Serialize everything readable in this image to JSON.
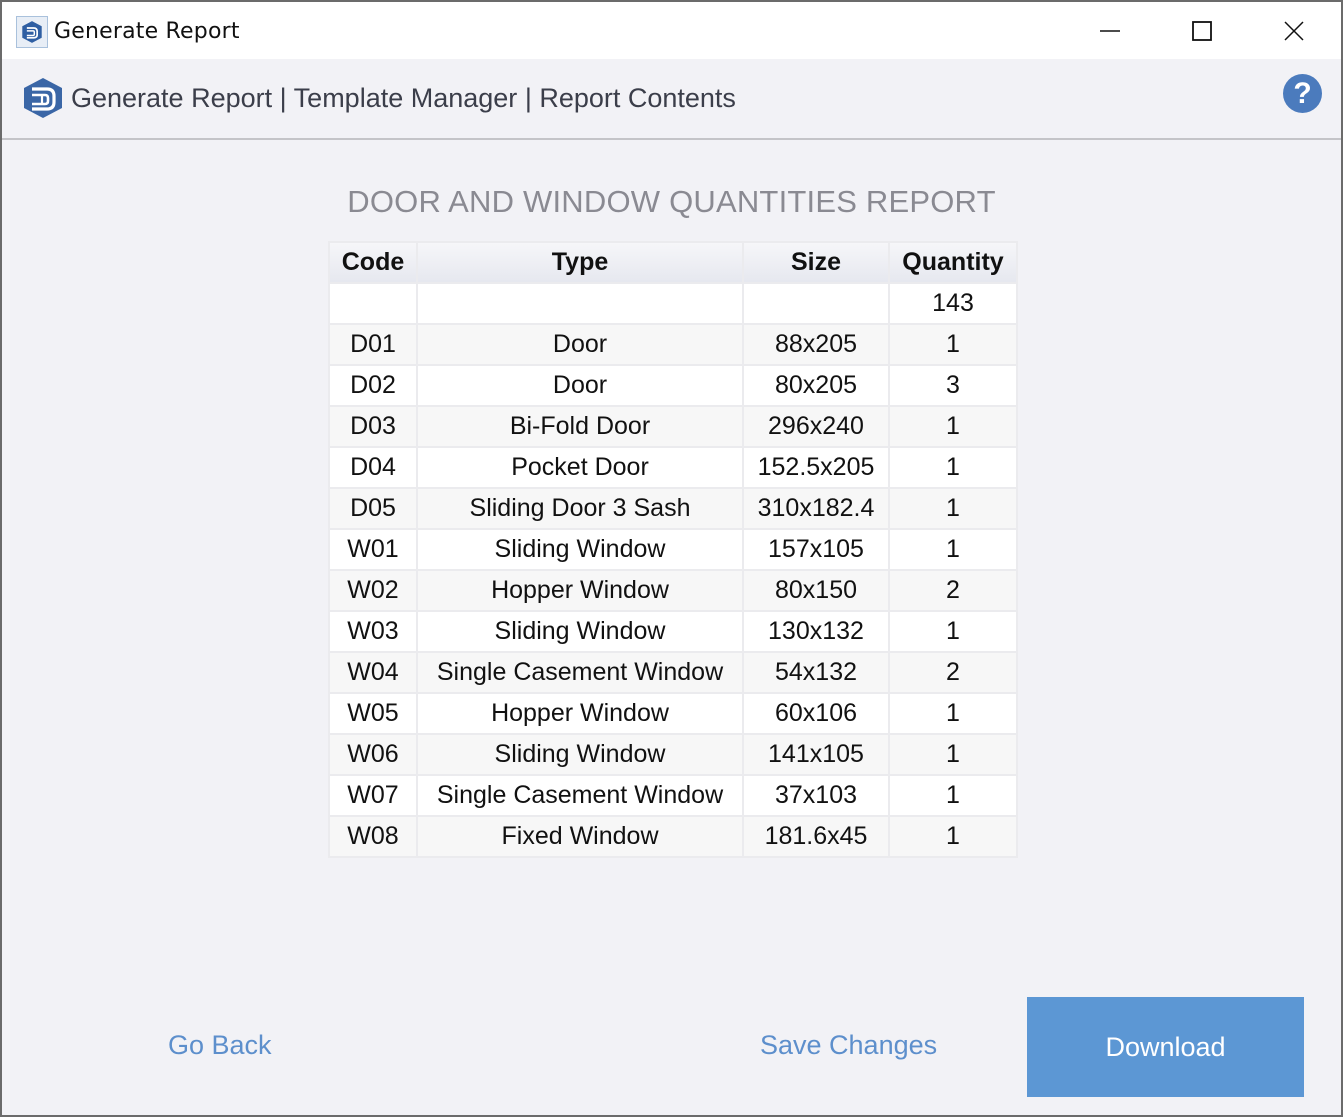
{
  "window": {
    "title": "Generate Report",
    "controls": {
      "minimize": "minimize-icon",
      "maximize": "maximize-icon",
      "close": "close-icon"
    }
  },
  "header": {
    "breadcrumb": [
      {
        "label": "Generate Report"
      },
      {
        "label": "Template Manager"
      },
      {
        "label": "Report Contents"
      }
    ],
    "separator": "|",
    "help_icon": "?"
  },
  "report": {
    "title": "DOOR AND WINDOW QUANTITIES REPORT",
    "columns": [
      "Code",
      "Type",
      "Size",
      "Quantity"
    ],
    "total_row": {
      "code": "",
      "type": "",
      "size": "",
      "quantity": "143"
    },
    "rows": [
      {
        "code": "D01",
        "type": "Door",
        "size": "88x205",
        "quantity": "1"
      },
      {
        "code": "D02",
        "type": "Door",
        "size": "80x205",
        "quantity": "3"
      },
      {
        "code": "D03",
        "type": "Bi-Fold Door",
        "size": "296x240",
        "quantity": "1"
      },
      {
        "code": "D04",
        "type": "Pocket Door",
        "size": "152.5x205",
        "quantity": "1"
      },
      {
        "code": "D05",
        "type": "Sliding Door 3 Sash",
        "size": "310x182.4",
        "quantity": "1"
      },
      {
        "code": "W01",
        "type": "Sliding Window",
        "size": "157x105",
        "quantity": "1"
      },
      {
        "code": "W02",
        "type": "Hopper Window",
        "size": "80x150",
        "quantity": "2"
      },
      {
        "code": "W03",
        "type": "Sliding Window",
        "size": "130x132",
        "quantity": "1"
      },
      {
        "code": "W04",
        "type": "Single Casement Window",
        "size": "54x132",
        "quantity": "2"
      },
      {
        "code": "W05",
        "type": "Hopper Window",
        "size": "60x106",
        "quantity": "1"
      },
      {
        "code": "W06",
        "type": "Sliding Window",
        "size": "141x105",
        "quantity": "1"
      },
      {
        "code": "W07",
        "type": "Single Casement Window",
        "size": "37x103",
        "quantity": "1"
      },
      {
        "code": "W08",
        "type": "Fixed Window",
        "size": "181.6x45",
        "quantity": "1"
      }
    ]
  },
  "footer": {
    "go_back": "Go Back",
    "save_changes": "Save Changes",
    "download": "Download"
  },
  "colors": {
    "accent": "#5c97d4",
    "link": "#5d8fcc",
    "help": "#4b7bbd",
    "title_gray": "#8a8a92"
  }
}
